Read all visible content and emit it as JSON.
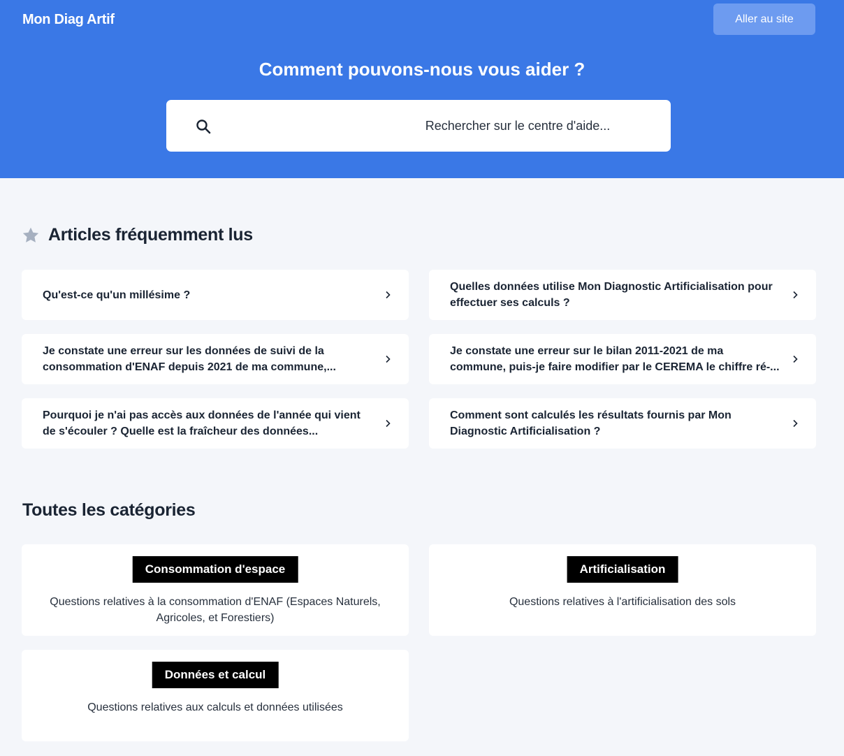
{
  "header": {
    "brand": "Mon Diag Artif",
    "site_button": "Aller au site",
    "title": "Comment pouvons-nous vous aider ?"
  },
  "search": {
    "placeholder": "Rechercher sur le centre d'aide..."
  },
  "popular": {
    "title": "Articles fréquemment lus",
    "articles": [
      {
        "label": "Qu'est-ce qu'un millésime ?"
      },
      {
        "label": "Quelles données utilise Mon Diagnostic Artificialisation pour effectuer ses calculs ?"
      },
      {
        "label": "Je constate une erreur sur les données de suivi de la consommation d'ENAF depuis 2021 de ma commune,..."
      },
      {
        "label": "Je constate une erreur sur le bilan 2011-2021 de ma commune, puis-je faire modifier par le CEREMA le chiffre ré-..."
      },
      {
        "label": "Pourquoi je n'ai pas accès aux données de l'année qui vient de s'écouler ? Quelle est la fraîcheur des données..."
      },
      {
        "label": "Comment sont calculés les résultats fournis par Mon Diagnostic Artificialisation ?"
      }
    ]
  },
  "categories": {
    "title": "Toutes les catégories",
    "items": [
      {
        "name": "Consommation d'espace",
        "description": "Questions relatives à la consommation d'ENAF (Espaces Naturels, Agricoles, et Forestiers)"
      },
      {
        "name": "Artificialisation",
        "description": "Questions relatives à l'artificialisation des sols"
      },
      {
        "name": "Données et calcul",
        "description": "Questions relatives aux calculs et données utilisées"
      }
    ]
  },
  "colors": {
    "header_bg": "#3a78e6",
    "page_bg": "#f4f6fa",
    "badge_bg": "#000000"
  }
}
